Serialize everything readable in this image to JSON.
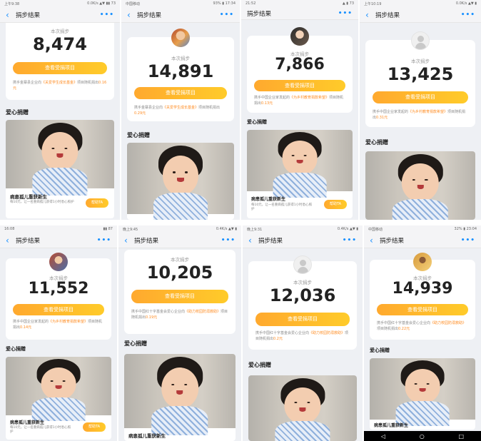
{
  "header": {
    "title": "捐步结果",
    "more": "•••",
    "back": "‹"
  },
  "labels": {
    "steps": "本次捐步",
    "view_project": "查看受捐项目",
    "love_donation": "爱心捐赠",
    "help_button": "帮助TA"
  },
  "project": {
    "title": "病患孤儿重获新生",
    "desc": "每10元，让一名重病孤儿获得1小时悉心照护"
  },
  "icons": {
    "back": "back-arrow-icon",
    "more": "more-dots-icon",
    "avatar_default": "user-avatar-icon"
  },
  "colors": {
    "accent": "#ffb62d",
    "link": "#1890ff",
    "highlight": "#ff8a1e"
  },
  "panels": [
    {
      "status_left": "上午9:38",
      "status_right": "0.0K/s ▲▼ ▮▮ 73",
      "steps": "8,474",
      "note_pre": "携手金寨县企业向",
      "note_project": "《关爱学生成长基金》",
      "note_post": "项目随机捐出",
      "note_amount": "0.16元"
    },
    {
      "status_left": "中国移动",
      "status_right": "93% ▮ 17:34",
      "steps": "14,891",
      "note_pre": "携手金寨县企业向",
      "note_project": "《关爱学生成长基金》",
      "note_post": "项目随机捐出",
      "note_amount": "0.29元"
    },
    {
      "status_left": "21:52",
      "status_right": "▲ ▮ 73",
      "steps": "7,866",
      "note_pre": "携手中国企业家发起的",
      "note_project": "《为乡村教育捐款希望》",
      "note_post": "项目随机捐出",
      "note_amount": "0.13元"
    },
    {
      "status_left": "上午10:19",
      "status_right": "0.0K/s ▲▼ ▮",
      "steps": "13,425",
      "note_pre": "携手中国企业家发起的",
      "note_project": "《为乡村教育捐款希望》",
      "note_post": "项目随机捐出",
      "note_amount": "0.31元"
    },
    {
      "status_left": "16:08",
      "status_right": "▮▮ 87",
      "steps": "11,552",
      "note_pre": "携手中国企业家发起的",
      "note_project": "《为乡村教育捐款希望》",
      "note_post": "项目随机捐出",
      "note_amount": "0.14元"
    },
    {
      "status_left": "晚上9:45",
      "status_right": "0.4K/s ▲▼ ▮",
      "steps": "10,205",
      "note_pre": "携手中国红十字基金会爱心企业向",
      "note_project": "《助力校园防溺救助》",
      "note_post": "项目随机捐出",
      "note_amount": "0.19元"
    },
    {
      "status_left": "晚上9:31",
      "status_right": "0.4K/s ▲▼ ▮",
      "steps": "12,036",
      "note_pre": "携手中国红十字基金会爱心企业向",
      "note_project": "《助力校园防溺救助》",
      "note_post": "项目随机捐出",
      "note_amount": "0.2元"
    },
    {
      "status_left": "中国移动",
      "status_right": "32% ▮ 23:04",
      "steps": "14,939",
      "note_pre": "携手中国红十字基金会爱心企业向",
      "note_project": "《助力校园防溺救助》",
      "note_post": "项目随机捐出",
      "note_amount": "0.22元"
    }
  ]
}
